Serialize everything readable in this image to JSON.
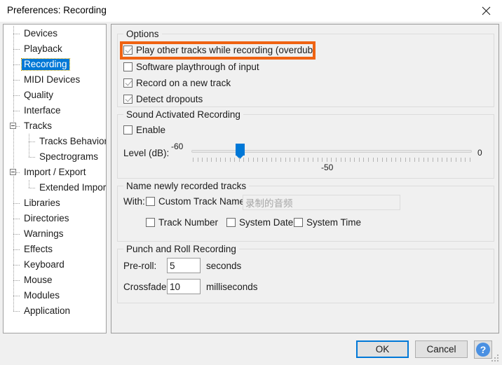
{
  "window": {
    "title": "Preferences: Recording",
    "close_icon": "close-icon"
  },
  "sidebar": {
    "items": [
      {
        "label": "Devices",
        "level": 1,
        "expander": false,
        "selected": false
      },
      {
        "label": "Playback",
        "level": 1,
        "expander": false,
        "selected": false
      },
      {
        "label": "Recording",
        "level": 1,
        "expander": false,
        "selected": true
      },
      {
        "label": "MIDI Devices",
        "level": 1,
        "expander": false,
        "selected": false
      },
      {
        "label": "Quality",
        "level": 1,
        "expander": false,
        "selected": false
      },
      {
        "label": "Interface",
        "level": 1,
        "expander": false,
        "selected": false
      },
      {
        "label": "Tracks",
        "level": 1,
        "expander": true,
        "selected": false
      },
      {
        "label": "Tracks Behaviors",
        "level": 2,
        "expander": false,
        "selected": false
      },
      {
        "label": "Spectrograms",
        "level": 2,
        "expander": false,
        "selected": false
      },
      {
        "label": "Import / Export",
        "level": 1,
        "expander": true,
        "selected": false
      },
      {
        "label": "Extended Import",
        "level": 2,
        "expander": false,
        "selected": false
      },
      {
        "label": "Libraries",
        "level": 1,
        "expander": false,
        "selected": false
      },
      {
        "label": "Directories",
        "level": 1,
        "expander": false,
        "selected": false
      },
      {
        "label": "Warnings",
        "level": 1,
        "expander": false,
        "selected": false
      },
      {
        "label": "Effects",
        "level": 1,
        "expander": false,
        "selected": false
      },
      {
        "label": "Keyboard",
        "level": 1,
        "expander": false,
        "selected": false
      },
      {
        "label": "Mouse",
        "level": 1,
        "expander": false,
        "selected": false
      },
      {
        "label": "Modules",
        "level": 1,
        "expander": false,
        "selected": false
      },
      {
        "label": "Application",
        "level": 1,
        "expander": false,
        "selected": false
      }
    ]
  },
  "options_group": {
    "title": "Options",
    "checkboxes": [
      {
        "label": "Play other tracks while recording (overdub)",
        "checked": true,
        "highlighted": true
      },
      {
        "label": "Software playthrough of input",
        "checked": false,
        "highlighted": false
      },
      {
        "label": "Record on a new track",
        "checked": true,
        "highlighted": false
      },
      {
        "label": "Detect dropouts",
        "checked": true,
        "highlighted": false
      }
    ],
    "highlight_color": "#ef6312"
  },
  "sound_activated_group": {
    "title": "Sound Activated Recording",
    "enable_label": "Enable",
    "enable_checked": false,
    "level_label": "Level (dB):",
    "min_label": "-60",
    "max_label": "0",
    "center_label": "-50",
    "value": -50,
    "min": -60,
    "max": 0,
    "thumb_color": "#0078d7"
  },
  "name_tracks_group": {
    "title": "Name newly recorded tracks",
    "with_label": "With:",
    "custom_track_name_label": "Custom Track Name",
    "custom_track_name_checked": false,
    "custom_name_value": "录制的音频",
    "track_number_label": "Track Number",
    "track_number_checked": false,
    "system_date_label": "System Date",
    "system_date_checked": false,
    "system_time_label": "System Time",
    "system_time_checked": false
  },
  "punch_roll_group": {
    "title": "Punch and Roll Recording",
    "preroll_label": "Pre-roll:",
    "preroll_value": "5",
    "preroll_units": "seconds",
    "crossfade_label": "Crossfade:",
    "crossfade_value": "10",
    "crossfade_units": "milliseconds"
  },
  "footer": {
    "ok_label": "OK",
    "cancel_label": "Cancel",
    "help_glyph": "?"
  }
}
